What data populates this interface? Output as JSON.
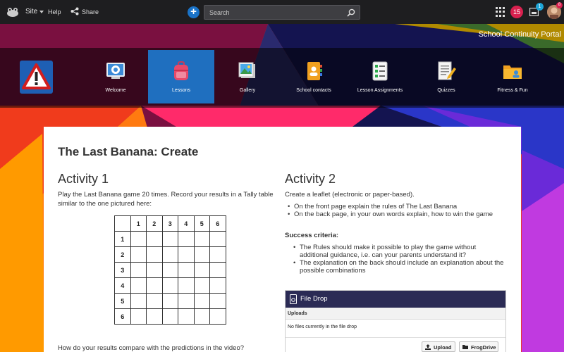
{
  "topbar": {
    "site_label": "Site",
    "help_label": "Help",
    "share_label": "Share",
    "search_placeholder": "Search",
    "notifications_count": "15",
    "messages_count": "1",
    "avatar_count": "8"
  },
  "portal_title": "School Continuity Portal",
  "nav": {
    "items": [
      {
        "label": "Welcome"
      },
      {
        "label": "Lessons"
      },
      {
        "label": "Gallery"
      },
      {
        "label": "School contacts"
      },
      {
        "label": "Lesson Assignments"
      },
      {
        "label": "Quizzes"
      },
      {
        "label": "Fitness & Fun"
      }
    ],
    "active": "Lessons"
  },
  "page": {
    "title": "The Last Banana: Create",
    "activity1": {
      "title": "Activity 1",
      "text": "Play the Last Banana game 20 times.  Record your results in a Tally table similar to the one pictured here:",
      "table_headers": [
        "1",
        "2",
        "3",
        "4",
        "5",
        "6"
      ],
      "table_rows": [
        "1",
        "2",
        "3",
        "4",
        "5",
        "6"
      ],
      "question": "How do your results compare with the predictions in the video?"
    },
    "activity2": {
      "title": "Activity 2",
      "intro": "Create a leaflet (electronic or paper-based).",
      "bullets": [
        "On the front page explain the rules of The Last Banana",
        "On the back page, in your own words explain, how to win the game"
      ],
      "success_title": "Success criteria:",
      "success_bullets": [
        "The Rules should make it possible to play the game without additional guidance, i.e. can your parents understand it?",
        "The explanation on the back should include an explanation about the possible combinations"
      ]
    },
    "file_drop": {
      "title": "File Drop",
      "uploads_label": "Uploads",
      "empty_text": "No files currently in the file drop",
      "upload_button": "Upload",
      "frogdrive_button": "FrogDrive"
    }
  }
}
